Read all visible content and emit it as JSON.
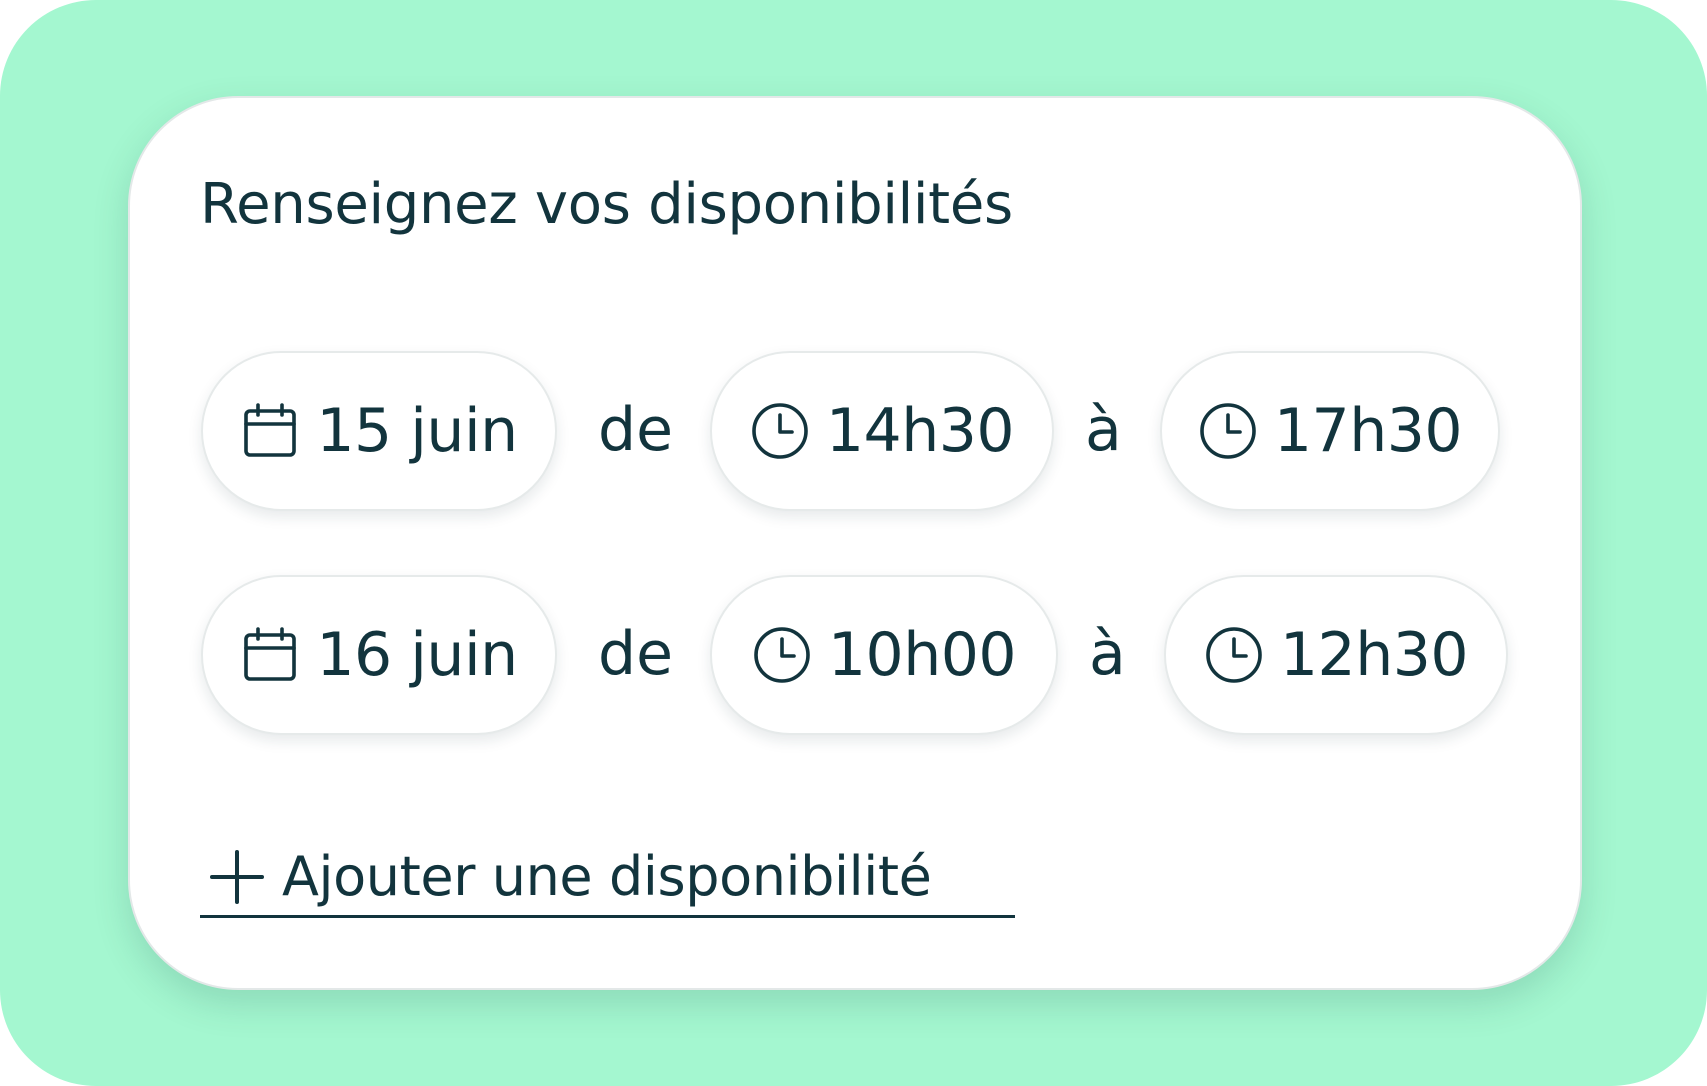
{
  "colors": {
    "backdrop": "#a4f7d0",
    "card": "#ffffff",
    "text": "#12343d"
  },
  "title": "Renseignez vos disponibilités",
  "rows": [
    {
      "date": {
        "icon": "calendar-icon",
        "label": "15 juin"
      },
      "from_word": "de",
      "start": {
        "icon": "clock-icon",
        "label": "14h30"
      },
      "to_word": "à",
      "end": {
        "icon": "clock-icon",
        "label": "17h30"
      }
    },
    {
      "date": {
        "icon": "calendar-icon",
        "label": "16 juin"
      },
      "from_word": "de",
      "start": {
        "icon": "clock-icon",
        "label": "10h00"
      },
      "to_word": "à",
      "end": {
        "icon": "clock-icon",
        "label": "12h30"
      }
    }
  ],
  "add_action": {
    "icon": "plus-icon",
    "label": "Ajouter une disponibilité"
  }
}
